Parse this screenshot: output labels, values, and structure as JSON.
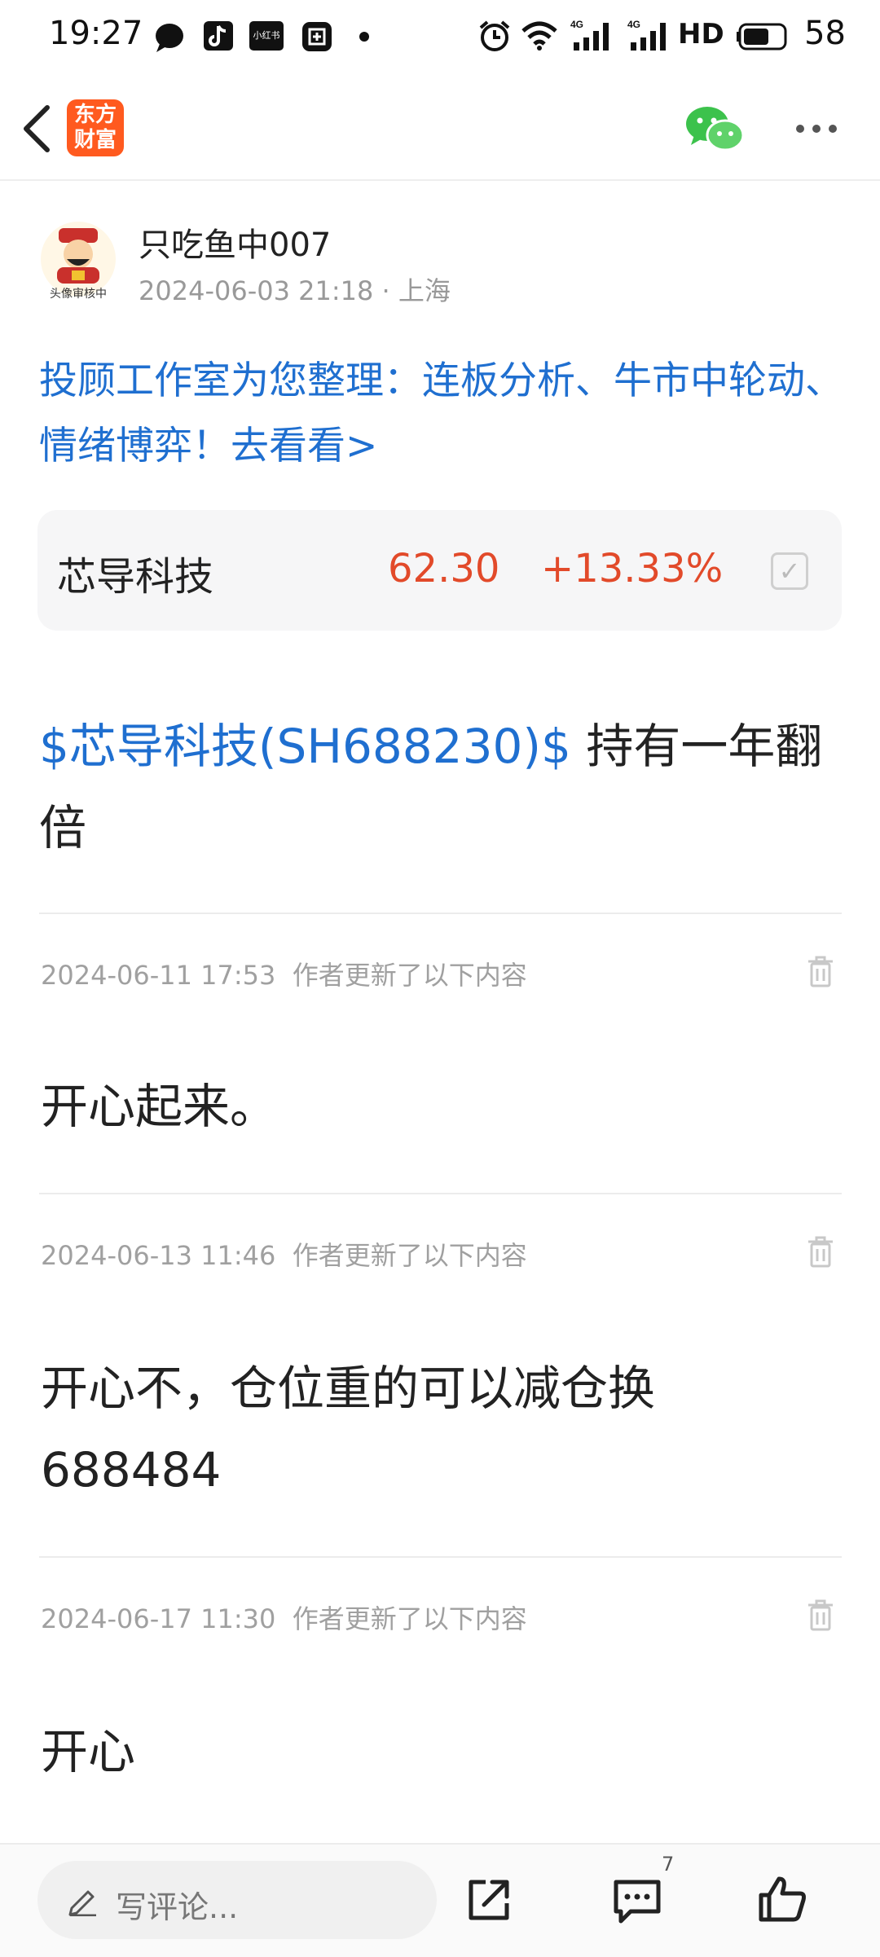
{
  "status_bar": {
    "time": "19:27",
    "battery": "58",
    "icons": [
      "chat-bubble-icon",
      "tiktok-icon",
      "xiaohongshu-icon",
      "meituan-icon",
      "dot-icon",
      "alarm-icon",
      "wifi-icon",
      "signal-4g-icon",
      "signal-4g-icon",
      "hd-icon",
      "battery-icon"
    ],
    "xiaohongshu_label": "小红书",
    "hd_label": "HD"
  },
  "nav": {
    "logo_text": "东方财富",
    "logo_line1": "东方",
    "logo_line2": "财富",
    "brand_color": "#ff5a1f"
  },
  "author": {
    "name": "只吃鱼中007",
    "date": "2024-06-03 21:18",
    "location": "上海",
    "avatar_caption": "头像审核中"
  },
  "promo_text": "投顾工作室为您整理：连板分析、牛市中轮动、情绪博弈！去看看>",
  "stock_card": {
    "name": "芯导科技",
    "price": "62.30",
    "change": "+13.33%",
    "up_color": "#e24a2a"
  },
  "post": {
    "stock_link": "$芯导科技(SH688230)$",
    "title_rest": " 持有一年翻倍"
  },
  "updates": [
    {
      "time": "2024-06-11 17:53",
      "label": "作者更新了以下内容",
      "text": "开心起来。"
    },
    {
      "time": "2024-06-13 11:46",
      "label": "作者更新了以下内容",
      "text": "开心不，仓位重的可以减仓换688484"
    },
    {
      "time": "2024-06-17 11:30",
      "label": "作者更新了以下内容",
      "text": "开心"
    }
  ],
  "bottom_bar": {
    "comment_placeholder": "写评论...",
    "comment_count": "7"
  }
}
